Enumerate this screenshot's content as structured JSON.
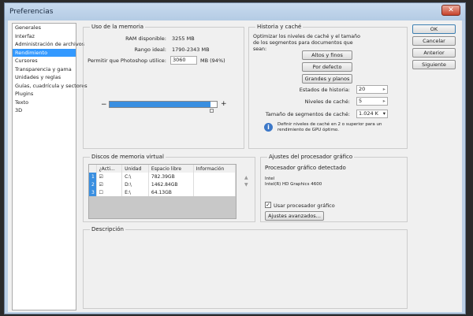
{
  "window": {
    "title": "Preferencias",
    "close": "✕"
  },
  "sidebar": {
    "items": [
      {
        "label": "Generales"
      },
      {
        "label": "Interfaz"
      },
      {
        "label": "Administración de archivos"
      },
      {
        "label": "Rendimiento",
        "selected": true
      },
      {
        "label": "Cursores"
      },
      {
        "label": "Transparencia y gama"
      },
      {
        "label": "Unidades y reglas"
      },
      {
        "label": "Guías, cuadrícula y sectores"
      },
      {
        "label": "Plugins"
      },
      {
        "label": "Texto"
      },
      {
        "label": "3D"
      }
    ]
  },
  "memory": {
    "title": "Uso de la memoria",
    "ram_label": "RAM disponible:",
    "ram_value": "3255 MB",
    "range_label": "Rango ideal:",
    "range_value": "1790-2343 MB",
    "allow_label": "Permitir que Photoshop utilice:",
    "allow_value": "3060",
    "allow_unit": "MB (94%)",
    "slider_percent": 94,
    "minus": "−",
    "plus": "+"
  },
  "history": {
    "title": "Historia y caché",
    "desc": "Optimizar los niveles de caché y el tamaño de los segmentos para documentos que sean:",
    "btn1": "Altos y finos",
    "btn2": "Por defecto",
    "btn3": "Grandes y planos",
    "states_label": "Estados de historia:",
    "states_value": "20",
    "levels_label": "Niveles de caché:",
    "levels_value": "5",
    "tile_label": "Tamaño de segmentos de caché:",
    "tile_value": "1.024 K",
    "info": "Definir niveles de caché en 2 o superior para un rendimiento de GPU óptimo."
  },
  "buttons": {
    "ok": "OK",
    "cancel": "Cancelar",
    "prev": "Anterior",
    "next": "Siguiente"
  },
  "disks": {
    "title": "Discos de memoria virtual",
    "headers": [
      "¿Acti...",
      "Unidad",
      "Espacio libre",
      "Información"
    ],
    "rows": [
      {
        "n": "1",
        "active": true,
        "unit": "C:\\",
        "free": "782.39GB",
        "info": ""
      },
      {
        "n": "2",
        "active": true,
        "unit": "D:\\",
        "free": "1462.84GB",
        "info": ""
      },
      {
        "n": "3",
        "active": false,
        "unit": "E:\\",
        "free": "64.13GB",
        "info": ""
      }
    ]
  },
  "gpu": {
    "title": "Ajustes del procesador gráfico",
    "detected": "Procesador gráfico detectado",
    "vendor": "Intel",
    "model": "Intel(R) HD Graphics 4600",
    "use_label": "Usar procesador gráfico",
    "use_checked": true,
    "advanced": "Ajustes avanzados..."
  },
  "description": {
    "title": "Descripción"
  }
}
